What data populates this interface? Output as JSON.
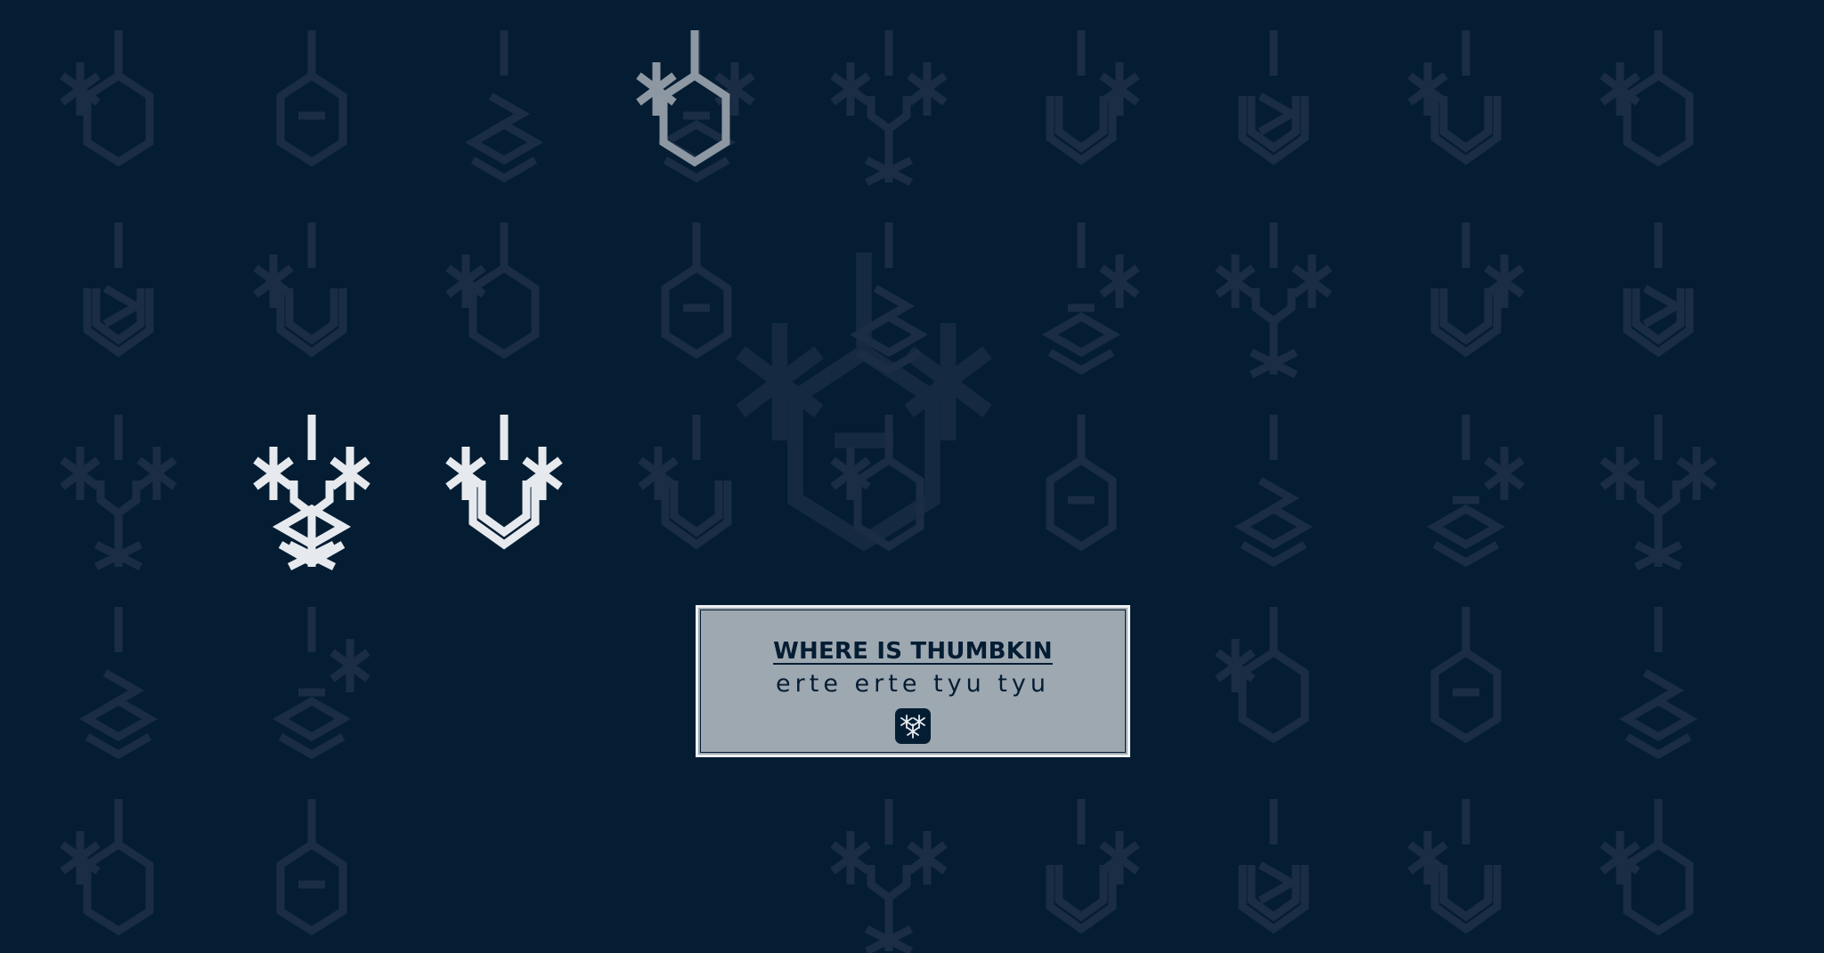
{
  "card": {
    "title": "WHERE IS THUMBKIN",
    "subtitle": "erte erte tyu tyu",
    "icon": "snowflake-icon"
  },
  "background": {
    "color": "#041d33",
    "pattern": "geometric-glyph-tiles",
    "faint_glyph_color": "#1a2d44",
    "highlight_glyph_color": "#e6eaef",
    "mid_glyph_color": "#8e98a3"
  },
  "colors": {
    "card_bg": "#9ea8b1",
    "card_border": "#eef1f4",
    "text": "#041d33"
  }
}
